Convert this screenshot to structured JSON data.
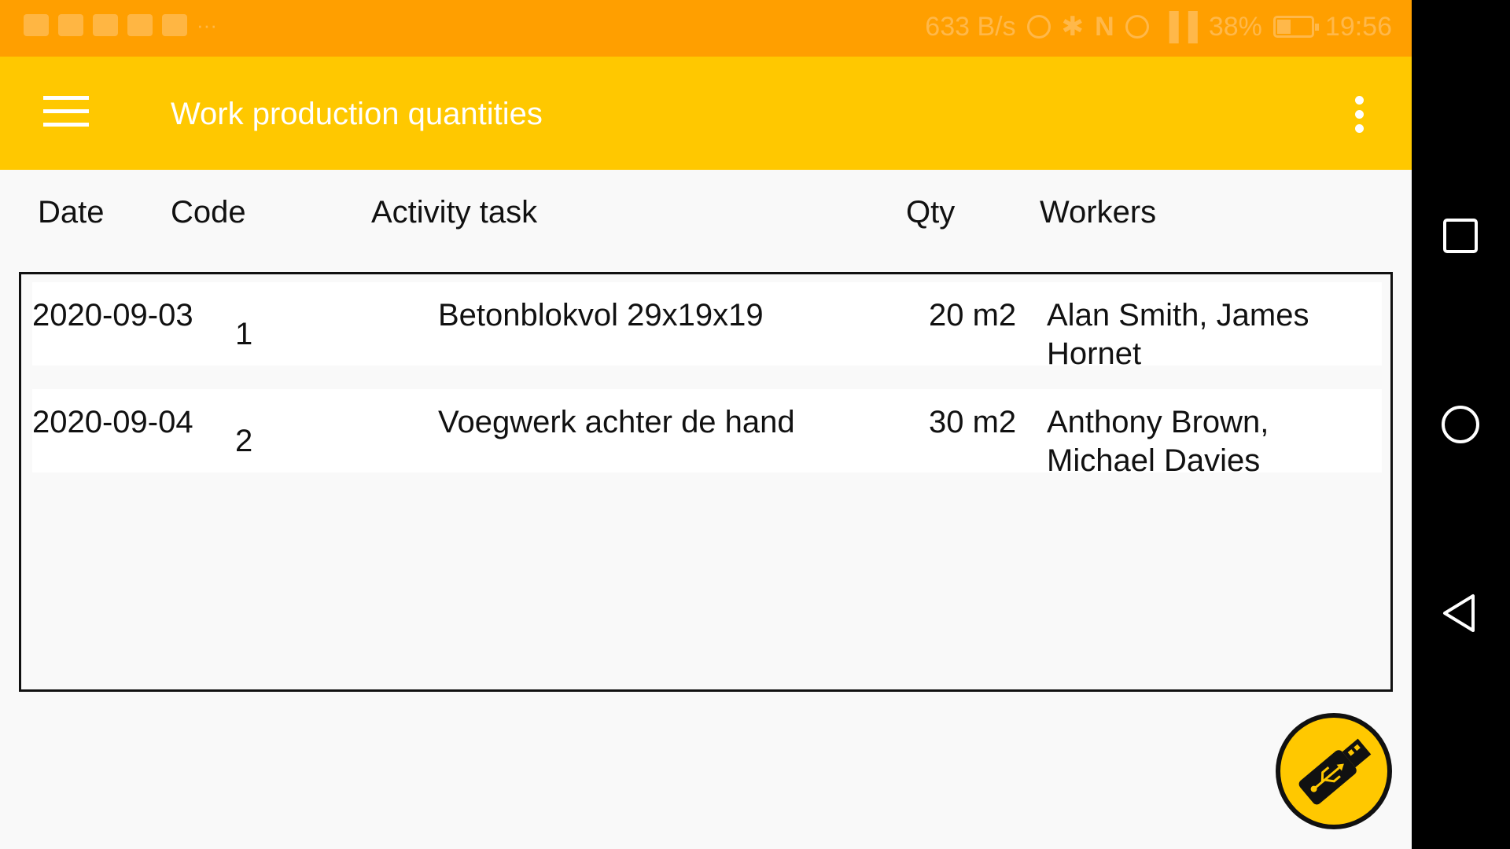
{
  "status_bar": {
    "speed": "633 B/s",
    "battery": "38%",
    "time": "19:56",
    "icons": [
      "notification-icon",
      "mail-icon",
      "gmail-icon",
      "youtube-icon",
      "calendar-icon",
      "more-dots-icon",
      "hotspot-icon",
      "bluetooth-icon",
      "nfc-icon",
      "eye-comfort-icon",
      "signal-icon",
      "battery-icon"
    ],
    "more": "···"
  },
  "app_bar": {
    "title": "Work production quantities",
    "menu_icon": "hamburger-menu-icon",
    "overflow_icon": "overflow-menu-icon",
    "color": "#ffc800"
  },
  "table": {
    "headers": {
      "date": "Date",
      "code": "Code",
      "task": "Activity task",
      "qty": "Qty",
      "workers": "Workers"
    },
    "rows": [
      {
        "date": "2020-09-03",
        "code": "1",
        "task": "Betonblokvol 29x19x19",
        "qty": "20 m2",
        "workers": "Alan Smith, James Hornet"
      },
      {
        "date": "2020-09-04",
        "code": "2",
        "task": "Voegwerk achter de hand",
        "qty": "30 m2",
        "workers": "Anthony Brown, Michael Davies"
      }
    ]
  },
  "fab": {
    "icon": "usb-drive-icon"
  },
  "nav_bar": {
    "recent_icon": "recent-apps-icon",
    "home_icon": "home-icon",
    "back_icon": "back-icon"
  }
}
